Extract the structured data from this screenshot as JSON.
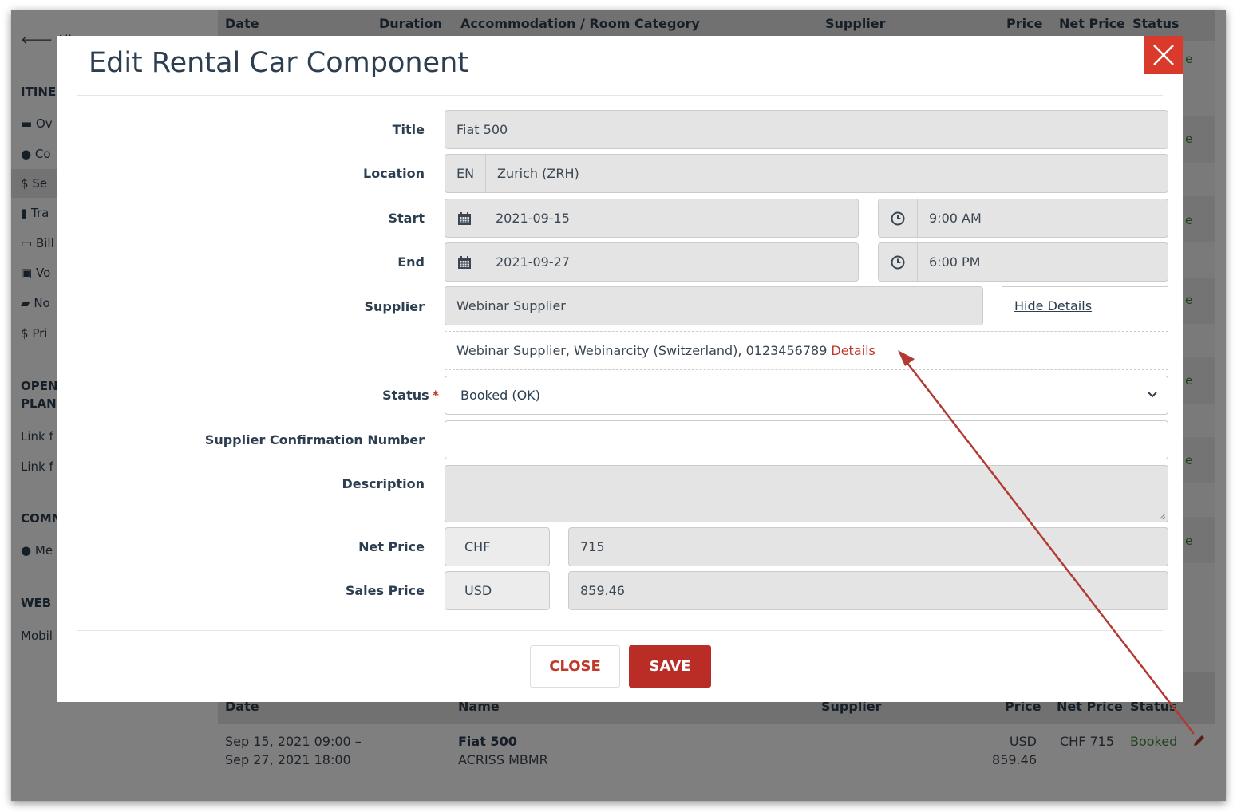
{
  "background": {
    "sidebar": {
      "back_link": "All",
      "section_itinerary": "ITINE",
      "items": [
        {
          "label": "Ov",
          "icon": "briefcase-icon"
        },
        {
          "label": "Co",
          "icon": "user-icon"
        },
        {
          "label": "Se",
          "icon": "dollar-icon"
        },
        {
          "label": "Tra",
          "icon": "book-icon"
        },
        {
          "label": "Bill",
          "icon": "credit-card-icon"
        },
        {
          "label": "Vo",
          "icon": "gift-icon"
        },
        {
          "label": "No",
          "icon": "comment-icon"
        },
        {
          "label": "Pri",
          "icon": "dollar-icon"
        }
      ],
      "section_open": "OPEN\nPLAN",
      "links": [
        "Link f",
        "Link f"
      ],
      "section_comm": "COMM",
      "comm_item": "Me",
      "section_web": "WEB",
      "web_item": "Mobil"
    },
    "table_top_headers": {
      "date": "Date",
      "duration": "Duration",
      "accommodation": "Accommodation / Room Category",
      "supplier": "Supplier",
      "price": "Price",
      "net_price": "Net Price",
      "status": "Status"
    },
    "status_fragment": "e",
    "table_bottom_headers": {
      "date": "Date",
      "name": "Name",
      "supplier": "Supplier",
      "price": "Price",
      "net_price": "Net Price",
      "status": "Status"
    },
    "row": {
      "date_line1": "Sep 15, 2021 09:00 –",
      "date_line2": "Sep 27, 2021 18:00",
      "name": "Fiat 500",
      "name_sub": "ACRISS MBMR",
      "price_line1": "USD",
      "price_line2": "859.46",
      "net_price": "CHF 715",
      "status": "Booked"
    }
  },
  "modal": {
    "title": "Edit Rental Car Component",
    "fields": {
      "title": {
        "label": "Title",
        "value": "Fiat 500"
      },
      "location": {
        "label": "Location",
        "lang": "EN",
        "value": "Zurich (ZRH)"
      },
      "start": {
        "label": "Start",
        "date": "2021-09-15",
        "time": "9:00 AM"
      },
      "end": {
        "label": "End",
        "date": "2021-09-27",
        "time": "6:00 PM"
      },
      "supplier": {
        "label": "Supplier",
        "value": "Webinar Supplier",
        "toggle_label": "Hide Details"
      },
      "supplier_details": {
        "text": "Webinar Supplier, Webinarcity (Switzerland), 0123456789",
        "link": "Details"
      },
      "status": {
        "label": "Status",
        "required_mark": "*",
        "value": "Booked (OK)"
      },
      "confirmation": {
        "label": "Supplier Confirmation Number",
        "value": ""
      },
      "description": {
        "label": "Description",
        "value": ""
      },
      "net_price": {
        "label": "Net Price",
        "currency": "CHF",
        "value": "715"
      },
      "sales_price": {
        "label": "Sales Price",
        "currency": "USD",
        "value": "859.46"
      }
    },
    "buttons": {
      "close": "CLOSE",
      "save": "SAVE"
    }
  },
  "colors": {
    "accent_red": "#b92d26",
    "close_x_red": "#d93a2b",
    "link_red": "#c0392b",
    "status_green": "#3c8c3c",
    "arrow": "#b23a32"
  }
}
